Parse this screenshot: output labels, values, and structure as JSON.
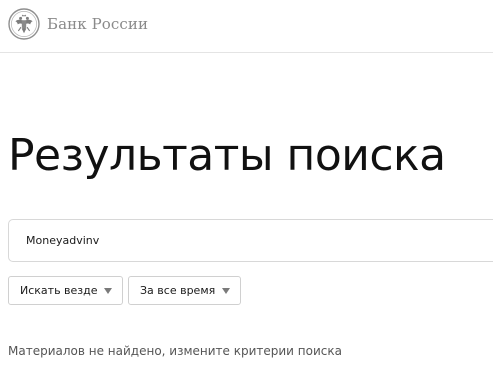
{
  "header": {
    "brand_name": "Банк России",
    "emblem_icon": "double-headed-eagle-icon"
  },
  "main": {
    "title": "Результаты поиска",
    "search": {
      "value": "Moneyadvinv",
      "placeholder": ""
    },
    "filters": [
      {
        "label": "Искать везде",
        "icon": "triangle-down-icon"
      },
      {
        "label": "За все время",
        "icon": "triangle-down-icon"
      }
    ],
    "empty_message": "Материалов не найдено, измените критерии поиска"
  }
}
